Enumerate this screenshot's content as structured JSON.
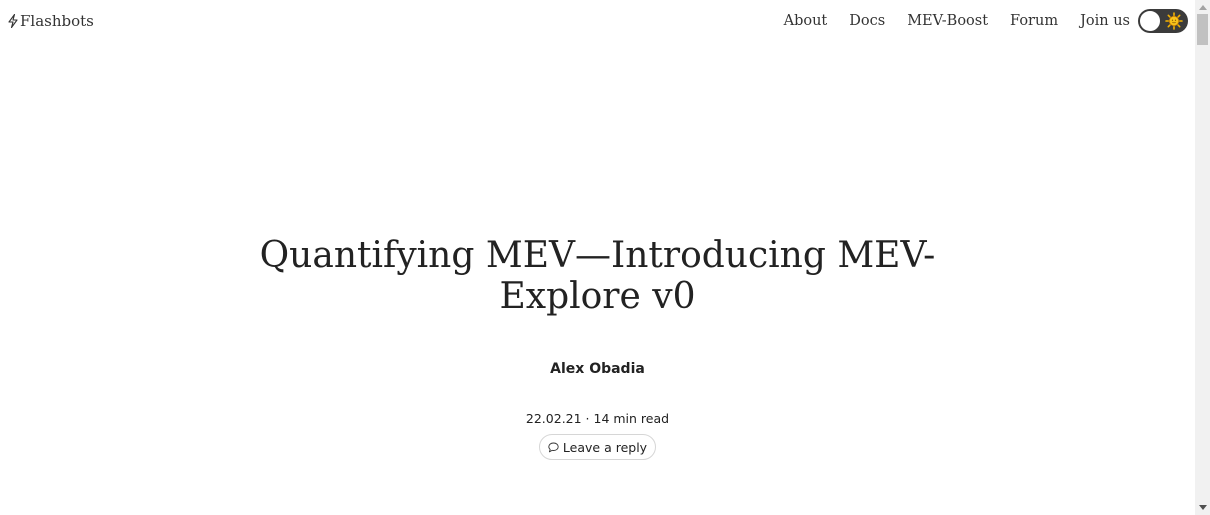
{
  "header": {
    "logo_text": "Flashbots",
    "nav": [
      {
        "label": "About"
      },
      {
        "label": "Docs"
      },
      {
        "label": "MEV-Boost"
      },
      {
        "label": "Forum"
      },
      {
        "label": "Join us"
      }
    ],
    "theme_toggle": {
      "state": "light",
      "icon": "sun-icon"
    }
  },
  "article": {
    "title_line1": "Quantifying MEV—Introducing MEV-",
    "title_line2": "Explore v0",
    "author": "Alex Obadia",
    "meta": "22.02.21 · 14 min read",
    "reply_label": "Leave a reply"
  },
  "colors": {
    "text": "#222222",
    "toggle_bg": "#3b3b3b",
    "sun": "#f5b301"
  }
}
